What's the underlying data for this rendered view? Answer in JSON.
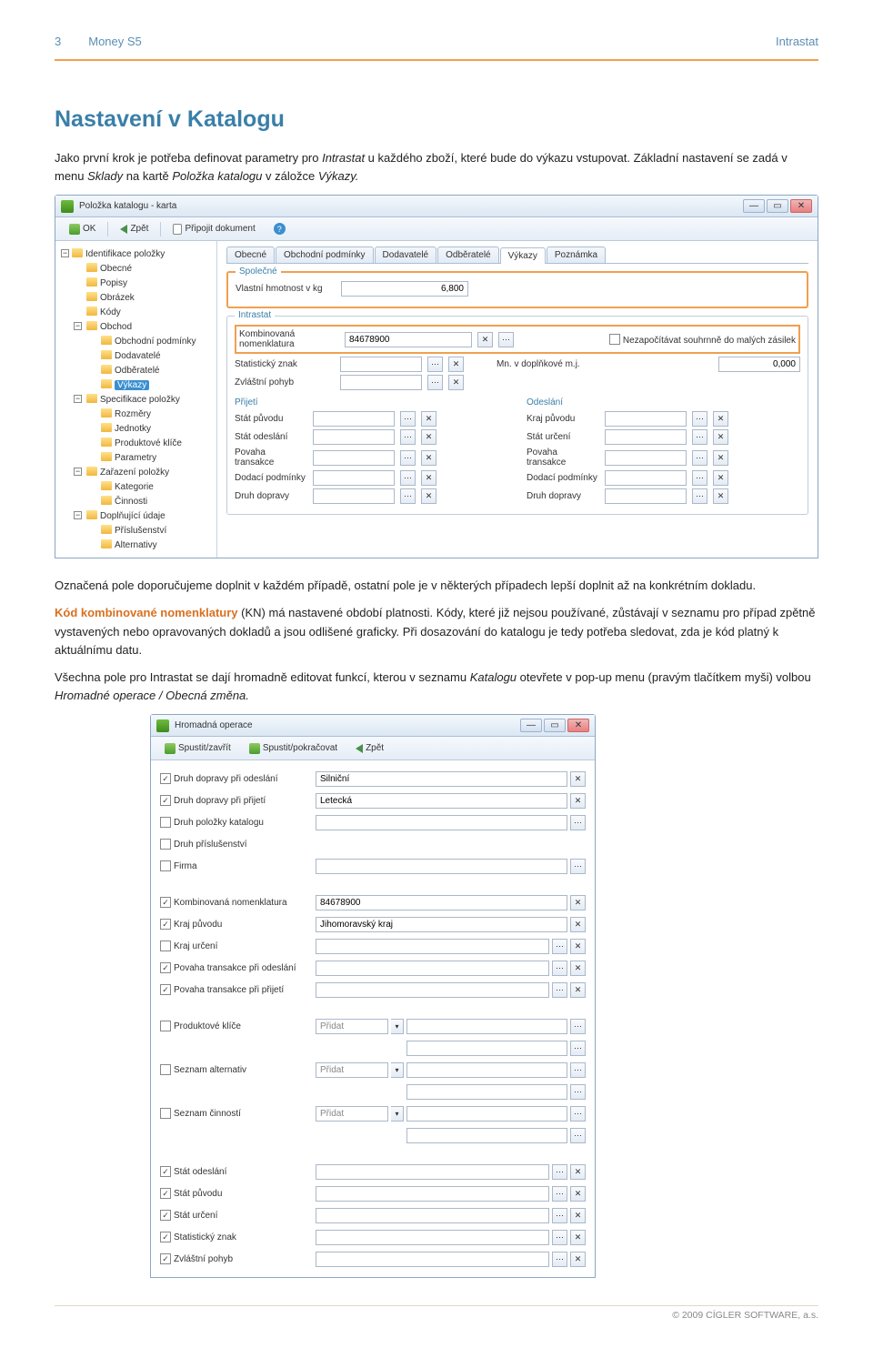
{
  "header": {
    "num": "3",
    "left": "Money S5",
    "right": "Intrastat"
  },
  "title": "Nastavení v Katalogu",
  "para1a": "Jako první krok je potřeba definovat parametry pro ",
  "para1b": " u každého zboží, které bude do výkazu vstupovat. Základní nastavení se zadá v menu ",
  "para1c": " na kartě ",
  "para1d": " v záložce ",
  "para1_i1": "Intrastat",
  "para1_i2": "Sklady",
  "para1_i3": "Položka katalogu",
  "para1_i4": "Výkazy.",
  "win1": {
    "title": "Položka katalogu - karta",
    "tb_ok": "OK",
    "tb_zpet": "Zpět",
    "tb_attach": "Připojit dokument",
    "tree_root": "Identifikace položky",
    "tree_items": [
      "Obecné",
      "Popisy",
      "Obrázek",
      "Kódy"
    ],
    "tree_obchod": "Obchod",
    "tree_obchod_items": [
      "Obchodní podmínky",
      "Dodavatelé",
      "Odběratelé",
      "Výkazy"
    ],
    "tree_spec": "Specifikace položky",
    "tree_spec_items": [
      "Rozměry",
      "Jednotky",
      "Produktové klíče",
      "Parametry"
    ],
    "tree_zar": "Zařazení položky",
    "tree_zar_items": [
      "Kategorie",
      "Činnosti"
    ],
    "tree_dop": "Doplňující údaje",
    "tree_dop_items": [
      "Příslušenství",
      "Alternativy"
    ],
    "tabs": [
      "Obecné",
      "Obchodní podmínky",
      "Dodavatelé",
      "Odběratelé",
      "Výkazy",
      "Poznámka"
    ],
    "grp_spolecne": "Společné",
    "lbl_hmotnost": "Vlastní hmotnost v kg",
    "val_hmotnost": "6,800",
    "grp_intrastat": "Intrastat",
    "lbl_kn": "Kombinovaná nomenklatura",
    "val_kn": "84678900",
    "chk_nezap": "Nezapočítávat souhrnně do malých zásilek",
    "lbl_stat_znak": "Statistický znak",
    "lbl_mn": "Mn. v doplňkové m.j.",
    "val_mn": "0,000",
    "lbl_zvl": "Zvláštní pohyb",
    "col_prijeti": "Přijetí",
    "col_odeslani": "Odeslání",
    "lbl_stat_puv": "Stát původu",
    "lbl_kraj_puv": "Kraj původu",
    "lbl_stat_odesl": "Stát odeslání",
    "lbl_stat_urc": "Stát určení",
    "lbl_povaha": "Povaha transakce",
    "lbl_dodaci": "Dodací podmínky",
    "lbl_druh": "Druh dopravy"
  },
  "para2": "Označená pole doporučujeme doplnit v každém případě, ostatní pole je v některých případech lepší doplnit až na konkrétním dokladu.",
  "para3_o": "Kód kombinované nomenklatury",
  "para3a": " (KN) má nastavené období platnosti. Kódy, které již nejsou používané, zůstávají v seznamu pro případ zpětně vystavených nebo opravovaných dokladů a jsou odlišené graficky. Při dosazování do katalogu je tedy potřeba sledovat, zda je kód platný k aktuálnímu datu.",
  "para4a": "Všechna pole pro Intrastat se dají hromadně editovat funkcí, kterou v seznamu ",
  "para4b": " otevřete v pop-up menu (pravým tlačítkem myši) volbou ",
  "para4_i1": "Katalogu",
  "para4_i2": "Hromadné operace / Obecná změna.",
  "win2": {
    "title": "Hromadná operace",
    "tb_spustit": "Spustit/zavřít",
    "tb_pokr": "Spustit/pokračovat",
    "tb_zpet": "Zpět",
    "rows": [
      {
        "chk": true,
        "label": "Druh dopravy při odeslání",
        "val": "Silniční",
        "type": "sel-x"
      },
      {
        "chk": true,
        "label": "Druh dopravy při přijetí",
        "val": "Letecká",
        "type": "sel-x"
      },
      {
        "chk": false,
        "label": "Druh položky katalogu",
        "val": "",
        "type": "ell"
      },
      {
        "chk": false,
        "label": "Druh příslušenství",
        "val": "",
        "type": "none"
      },
      {
        "chk": false,
        "label": "Firma",
        "val": "",
        "type": "ell"
      },
      {
        "chk": true,
        "label": "Kombinovaná nomenklatura",
        "val": "84678900",
        "type": "sel-x"
      },
      {
        "chk": true,
        "label": "Kraj původu",
        "val": "Jihomoravský kraj",
        "type": "sel-x"
      },
      {
        "chk": false,
        "label": "Kraj určení",
        "val": "",
        "type": "ell-x"
      },
      {
        "chk": true,
        "label": "Povaha transakce při odeslání",
        "val": "",
        "type": "ell-x"
      },
      {
        "chk": true,
        "label": "Povaha transakce při přijetí",
        "val": "",
        "type": "ell-x"
      },
      {
        "chk": false,
        "label": "Produktové klíče",
        "val": "Přidat",
        "type": "combo-ell"
      },
      {
        "chk": false,
        "label": "Seznam alternativ",
        "val": "Přidat",
        "type": "combo-ell"
      },
      {
        "chk": false,
        "label": "Seznam činností",
        "val": "Přidat",
        "type": "combo-ell"
      },
      {
        "chk": true,
        "label": "Stát odeslání",
        "val": "",
        "type": "ell-x"
      },
      {
        "chk": true,
        "label": "Stát původu",
        "val": "",
        "type": "ell-x"
      },
      {
        "chk": true,
        "label": "Stát určení",
        "val": "",
        "type": "ell-x"
      },
      {
        "chk": true,
        "label": "Statistický znak",
        "val": "",
        "type": "ell-x"
      },
      {
        "chk": true,
        "label": "Zvláštní pohyb",
        "val": "",
        "type": "ell-x"
      }
    ]
  },
  "footer": "© 2009 CÍGLER SOFTWARE, a.s."
}
